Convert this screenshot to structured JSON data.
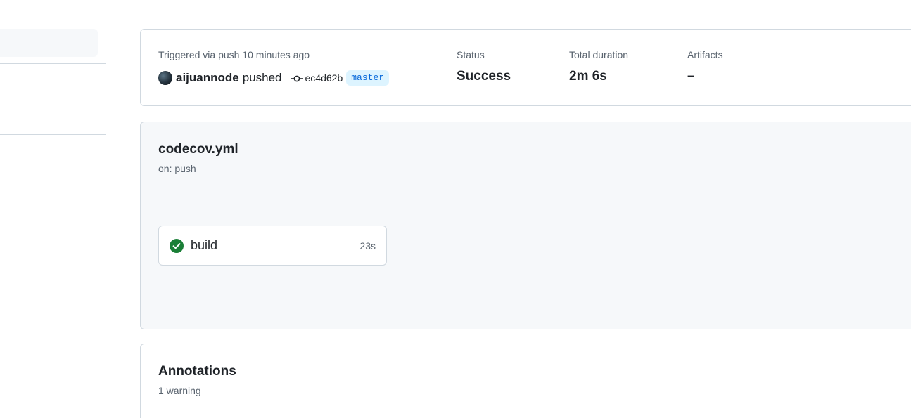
{
  "summary": {
    "trigger_text": "Triggered via push 10 minutes ago",
    "actor": "aijuannode",
    "action": "pushed",
    "commit_sha": "ec4d62b",
    "branch": "master",
    "stats": [
      {
        "label": "Status",
        "value": "Success"
      },
      {
        "label": "Total duration",
        "value": "2m 6s"
      },
      {
        "label": "Artifacts",
        "value": "–"
      }
    ]
  },
  "workflow": {
    "file_name": "codecov.yml",
    "trigger": "on: push",
    "jobs": [
      {
        "name": "build",
        "duration": "23s",
        "status": "success",
        "status_icon": "check-circle-fill-icon",
        "status_color": "#1a7f37"
      }
    ]
  },
  "annotations": {
    "title": "Annotations",
    "count_text": "1 warning"
  },
  "colors": {
    "accent_link": "#0969da",
    "branch_bg": "#ddf4ff",
    "success": "#1a7f37",
    "muted_text": "#59636e",
    "border": "#d1d9e0",
    "canvas_subtle": "#f6f8fa"
  }
}
